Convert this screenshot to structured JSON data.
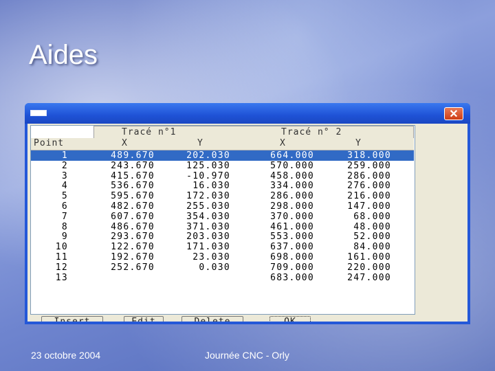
{
  "slide": {
    "title": "Aides",
    "footer_date": "23 octobre 2004",
    "footer_event": "Journée CNC - Orly"
  },
  "dialog": {
    "close_glyph": "✕",
    "groups": [
      "Tracé n°1",
      "Tracé n° 2"
    ],
    "columns": [
      "Point",
      "X",
      "Y",
      "X",
      "Y"
    ],
    "selected_row": 1,
    "rows": [
      {
        "point": "1",
        "x1": "489.670",
        "y1": "202.030",
        "x2": "664.000",
        "y2": "318.000"
      },
      {
        "point": "2",
        "x1": "243.670",
        "y1": "125.030",
        "x2": "570.000",
        "y2": "259.000"
      },
      {
        "point": "3",
        "x1": "415.670",
        "y1": "-10.970",
        "x2": "458.000",
        "y2": "286.000"
      },
      {
        "point": "4",
        "x1": "536.670",
        "y1": "16.030",
        "x2": "334.000",
        "y2": "276.000"
      },
      {
        "point": "5",
        "x1": "595.670",
        "y1": "172.030",
        "x2": "286.000",
        "y2": "216.000"
      },
      {
        "point": "6",
        "x1": "482.670",
        "y1": "255.030",
        "x2": "298.000",
        "y2": "147.000"
      },
      {
        "point": "7",
        "x1": "607.670",
        "y1": "354.030",
        "x2": "370.000",
        "y2": "68.000"
      },
      {
        "point": "8",
        "x1": "486.670",
        "y1": "371.030",
        "x2": "461.000",
        "y2": "48.000"
      },
      {
        "point": "9",
        "x1": "293.670",
        "y1": "203.030",
        "x2": "553.000",
        "y2": "52.000"
      },
      {
        "point": "10",
        "x1": "122.670",
        "y1": "171.030",
        "x2": "637.000",
        "y2": "84.000"
      },
      {
        "point": "11",
        "x1": "192.670",
        "y1": "23.030",
        "x2": "698.000",
        "y2": "161.000"
      },
      {
        "point": "12",
        "x1": "252.670",
        "y1": "0.030",
        "x2": "709.000",
        "y2": "220.000"
      },
      {
        "point": "13",
        "x1": "",
        "y1": "",
        "x2": "683.000",
        "y2": "247.000"
      }
    ],
    "buttons": [
      "Insert",
      "Edit",
      "Delete",
      "OK"
    ]
  }
}
